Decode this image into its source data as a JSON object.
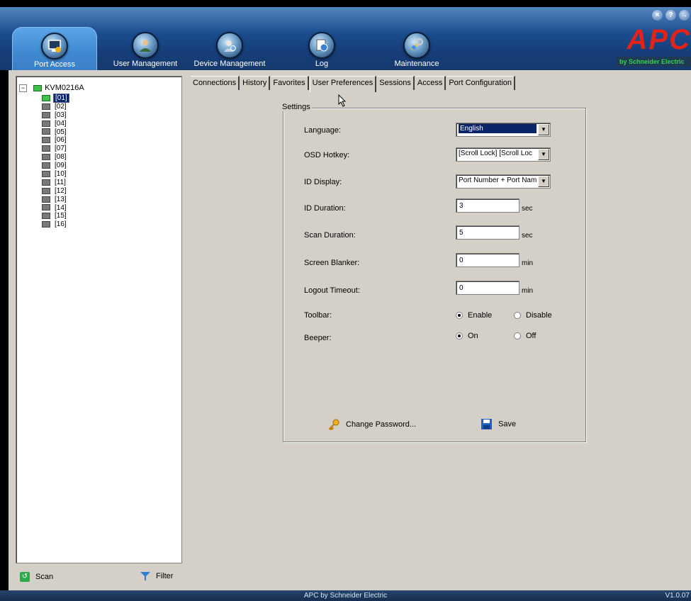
{
  "header": {
    "nav": [
      {
        "label": "Port Access",
        "icon": "port-access-icon",
        "active": true
      },
      {
        "label": "User Management",
        "icon": "user-management-icon"
      },
      {
        "label": "Device Management",
        "icon": "device-management-icon"
      },
      {
        "label": "Log",
        "icon": "log-icon"
      },
      {
        "label": "Maintenance",
        "icon": "maintenance-icon"
      }
    ],
    "window_buttons": {
      "close": "×",
      "help": "?",
      "logout": "→"
    },
    "logo": {
      "brand": "APC",
      "sub": "by Schneider Electric"
    }
  },
  "sidebar": {
    "root": "KVM0216A",
    "expander": "−",
    "ports": [
      "[01]",
      "[02]",
      "[03]",
      "[04]",
      "[05]",
      "[06]",
      "[07]",
      "[08]",
      "[09]",
      "[10]",
      "[11]",
      "[12]",
      "[13]",
      "[14]",
      "[15]",
      "[16]"
    ],
    "selected_port": "[01]",
    "scan_label": "Scan",
    "filter_label": "Filter"
  },
  "tabs": [
    "Connections",
    "History",
    "Favorites",
    "User Preferences",
    "Sessions",
    "Access",
    "Port Configuration"
  ],
  "active_tab": "User Preferences",
  "settings": {
    "legend": "Settings",
    "language": {
      "label": "Language:",
      "value": "English"
    },
    "osd_hotkey": {
      "label": "OSD Hotkey:",
      "value": "[Scroll Lock] [Scroll Loc"
    },
    "id_display": {
      "label": "ID Display:",
      "value": "Port Number + Port Nam"
    },
    "id_duration": {
      "label": "ID Duration:",
      "value": "3",
      "unit": "sec"
    },
    "scan_duration": {
      "label": "Scan Duration:",
      "value": "5",
      "unit": "sec"
    },
    "screen_blanker": {
      "label": "Screen Blanker:",
      "value": "0",
      "unit": "min"
    },
    "logout_timeout": {
      "label": "Logout Timeout:",
      "value": "0",
      "unit": "min"
    },
    "toolbar": {
      "label": "Toolbar:",
      "enable": "Enable",
      "disable": "Disable",
      "selected": "Enable"
    },
    "beeper": {
      "label": "Beeper:",
      "on": "On",
      "off": "Off",
      "selected": "On"
    },
    "change_password": "Change Password...",
    "save": "Save"
  },
  "status": {
    "center": "APC by Schneider Electric",
    "version": "V1.0.07"
  },
  "colors": {
    "header": "#1c4f92",
    "active_nav": "#4a95dc",
    "selection": "#0a246a",
    "panel_bg": "#d4d0c8",
    "logo_red": "#e2231a"
  }
}
